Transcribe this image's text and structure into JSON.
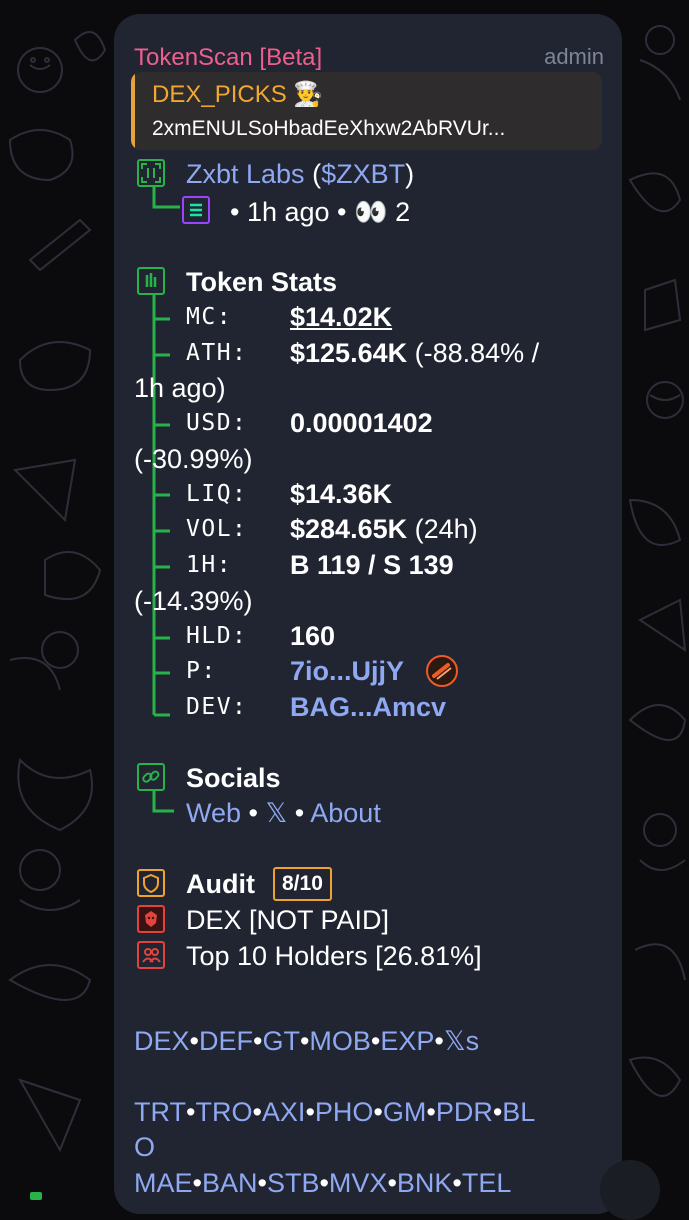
{
  "header": {
    "sender": "TokenScan [Beta]",
    "role": "admin"
  },
  "reply": {
    "title": "DEX_PICKS 👨‍🍳",
    "text": "2xmENULSoHbadEeXhxw2AbRVUr..."
  },
  "token": {
    "name": "Zxbt Labs",
    "ticker": "$ZXBT",
    "open_paren": "(",
    "close_paren": ")",
    "meta": "• 1h ago • 👀 2"
  },
  "stats": {
    "title": "Token Stats",
    "mc_label": "MC:",
    "mc_value": "$14.02K",
    "ath_label": "ATH:",
    "ath_value": "$125.64K",
    "ath_extra": "(-88.84% /",
    "ath_extra2": "1h ago)",
    "usd_label": "USD:",
    "usd_value": "0.00001402",
    "usd_extra": "(-30.99%)",
    "liq_label": "LIQ:",
    "liq_value": "$14.36K",
    "vol_label": "VOL:",
    "vol_value": "$284.65K",
    "vol_extra": "(24h)",
    "h1_label": "1H:",
    "h1_value": "B 119 / S 139",
    "h1_extra": "(-14.39%)",
    "hld_label": "HLD:",
    "hld_value": "160",
    "p_label": "P:",
    "p_value": "7io...UjjY",
    "dev_label": "DEV:",
    "dev_value": "BAG...Amcv"
  },
  "socials": {
    "title": "Socials",
    "web": "Web",
    "x": "𝕏",
    "about": "About",
    "sep": "•"
  },
  "audit": {
    "title": "Audit",
    "score": "8/10",
    "dex": "DEX [NOT PAID]",
    "holders": "Top 10 Holders [26.81%]"
  },
  "links": {
    "row1": [
      "DEX",
      "DEF",
      "GT",
      "MOB",
      "EXP",
      "𝕏s"
    ],
    "row2": [
      "TRT",
      "TRO",
      "AXI",
      "PHO",
      "GM",
      "PDR",
      "BL"
    ],
    "row2b": "O",
    "row3": [
      "MAE",
      "BAN",
      "STB",
      "MVX",
      "BNK",
      "TEL"
    ],
    "sep": "•"
  },
  "colors": {
    "bubble": "#212531",
    "link": "#8fa8f2",
    "sender": "#ef5f8e",
    "green": "#27b24a",
    "orange": "#f0a22e",
    "red": "#e0443c",
    "solana": "#9945ff"
  },
  "icons": {
    "token": "scan-frame-icon",
    "chain": "solana-icon",
    "stats": "bar-chart-icon",
    "socials": "link-icon",
    "audit": "shield-icon",
    "dex": "lion-icon",
    "holders": "users-icon",
    "platform": "pump-pill-icon"
  }
}
